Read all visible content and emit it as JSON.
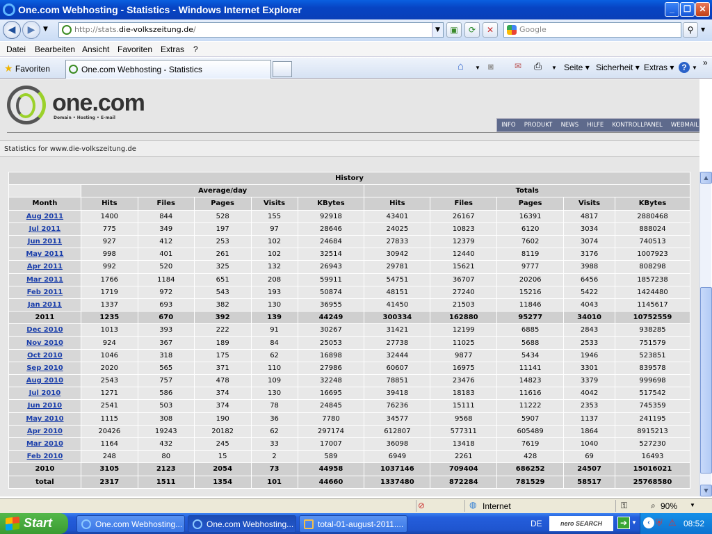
{
  "window": {
    "title": "One.com Webhosting - Statistics - Windows Internet Explorer"
  },
  "address": {
    "prefix": "http://stats.",
    "host": "die-volkszeitung.de",
    "path": "/"
  },
  "search": {
    "placeholder": "Google"
  },
  "menu": [
    "Datei",
    "Bearbeiten",
    "Ansicht",
    "Favoriten",
    "Extras",
    "?"
  ],
  "favorites": {
    "label": "Favoriten"
  },
  "tab": {
    "title": "One.com Webhosting - Statistics"
  },
  "commandbar": {
    "seite": "Seite",
    "sicherheit": "Sicherheit",
    "extras": "Extras"
  },
  "site": {
    "logo_text": "one.com",
    "logo_tagline": "Domain • Hosting • E-mail",
    "nav": [
      "INFO",
      "PRODUKT",
      "NEWS",
      "HILFE",
      "KONTROLLPANEL",
      "WEBMAIL"
    ],
    "stats_for_prefix": "Statistics for ",
    "stats_for_domain": "www.die-volkszeitung.de"
  },
  "table": {
    "title": "History",
    "group_avg": "Average/day",
    "group_tot": "Totals",
    "headers": [
      "Month",
      "Hits",
      "Files",
      "Pages",
      "Visits",
      "KBytes",
      "Hits",
      "Files",
      "Pages",
      "Visits",
      "KBytes"
    ],
    "rows": [
      {
        "m": "Aug 2011",
        "v": [
          "1400",
          "844",
          "528",
          "155",
          "92918",
          "43401",
          "26167",
          "16391",
          "4817",
          "2880468"
        ]
      },
      {
        "m": "Jul 2011",
        "v": [
          "775",
          "349",
          "197",
          "97",
          "28646",
          "24025",
          "10823",
          "6120",
          "3034",
          "888024"
        ]
      },
      {
        "m": "Jun 2011",
        "v": [
          "927",
          "412",
          "253",
          "102",
          "24684",
          "27833",
          "12379",
          "7602",
          "3074",
          "740513"
        ]
      },
      {
        "m": "May 2011",
        "v": [
          "998",
          "401",
          "261",
          "102",
          "32514",
          "30942",
          "12440",
          "8119",
          "3176",
          "1007923"
        ]
      },
      {
        "m": "Apr 2011",
        "v": [
          "992",
          "520",
          "325",
          "132",
          "26943",
          "29781",
          "15621",
          "9777",
          "3988",
          "808298"
        ]
      },
      {
        "m": "Mar 2011",
        "v": [
          "1766",
          "1184",
          "651",
          "208",
          "59911",
          "54751",
          "36707",
          "20206",
          "6456",
          "1857238"
        ]
      },
      {
        "m": "Feb 2011",
        "v": [
          "1719",
          "972",
          "543",
          "193",
          "50874",
          "48151",
          "27240",
          "15216",
          "5422",
          "1424480"
        ]
      },
      {
        "m": "Jan 2011",
        "v": [
          "1337",
          "693",
          "382",
          "130",
          "36955",
          "41450",
          "21503",
          "11846",
          "4043",
          "1145617"
        ]
      },
      {
        "m": "2011",
        "year": true,
        "v": [
          "1235",
          "670",
          "392",
          "139",
          "44249",
          "300334",
          "162880",
          "95277",
          "34010",
          "10752559"
        ]
      },
      {
        "m": "Dec 2010",
        "v": [
          "1013",
          "393",
          "222",
          "91",
          "30267",
          "31421",
          "12199",
          "6885",
          "2843",
          "938285"
        ]
      },
      {
        "m": "Nov 2010",
        "v": [
          "924",
          "367",
          "189",
          "84",
          "25053",
          "27738",
          "11025",
          "5688",
          "2533",
          "751579"
        ]
      },
      {
        "m": "Oct 2010",
        "v": [
          "1046",
          "318",
          "175",
          "62",
          "16898",
          "32444",
          "9877",
          "5434",
          "1946",
          "523851"
        ]
      },
      {
        "m": "Sep 2010",
        "v": [
          "2020",
          "565",
          "371",
          "110",
          "27986",
          "60607",
          "16975",
          "11141",
          "3301",
          "839578"
        ]
      },
      {
        "m": "Aug 2010",
        "v": [
          "2543",
          "757",
          "478",
          "109",
          "32248",
          "78851",
          "23476",
          "14823",
          "3379",
          "999698"
        ]
      },
      {
        "m": "Jul 2010",
        "v": [
          "1271",
          "586",
          "374",
          "130",
          "16695",
          "39418",
          "18183",
          "11616",
          "4042",
          "517542"
        ]
      },
      {
        "m": "Jun 2010",
        "v": [
          "2541",
          "503",
          "374",
          "78",
          "24845",
          "76236",
          "15111",
          "11222",
          "2353",
          "745359"
        ]
      },
      {
        "m": "May 2010",
        "v": [
          "1115",
          "308",
          "190",
          "36",
          "7780",
          "34577",
          "9568",
          "5907",
          "1137",
          "241195"
        ]
      },
      {
        "m": "Apr 2010",
        "v": [
          "20426",
          "19243",
          "20182",
          "62",
          "297174",
          "612807",
          "577311",
          "605489",
          "1864",
          "8915213"
        ]
      },
      {
        "m": "Mar 2010",
        "v": [
          "1164",
          "432",
          "245",
          "33",
          "17007",
          "36098",
          "13418",
          "7619",
          "1040",
          "527230"
        ]
      },
      {
        "m": "Feb 2010",
        "v": [
          "248",
          "80",
          "15",
          "2",
          "589",
          "6949",
          "2261",
          "428",
          "69",
          "16493"
        ]
      },
      {
        "m": "2010",
        "year": true,
        "v": [
          "3105",
          "2123",
          "2054",
          "73",
          "44958",
          "1037146",
          "709404",
          "686252",
          "24507",
          "15016021"
        ]
      },
      {
        "m": "total",
        "year": true,
        "v": [
          "2317",
          "1511",
          "1354",
          "101",
          "44660",
          "1337480",
          "872284",
          "781529",
          "58517",
          "25768580"
        ]
      }
    ]
  },
  "statusbar": {
    "zone": "Internet",
    "zoom": "90%"
  },
  "taskbar": {
    "start": "Start",
    "tasks": [
      "One.com Webhosting...",
      "One.com Webhosting...",
      "total-01-august-2011...."
    ],
    "nero": "nero SEARCH",
    "lang": "DE",
    "clock": "08:52"
  }
}
